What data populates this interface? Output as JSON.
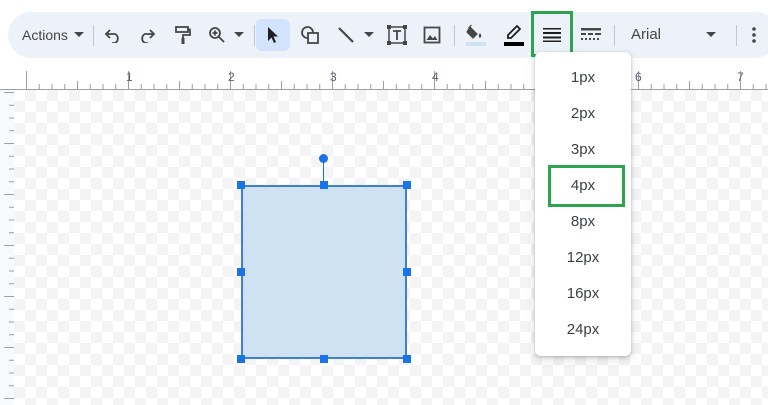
{
  "toolbar": {
    "actions_label": "Actions",
    "font_name": "Arial",
    "icons": [
      "undo-icon",
      "redo-icon",
      "paint-format-icon",
      "zoom-icon",
      "select-pointer-icon",
      "shape-icon",
      "line-icon",
      "text-box-icon",
      "image-icon",
      "fill-color-icon",
      "border-color-icon",
      "border-weight-icon",
      "border-dash-icon",
      "more-icon"
    ],
    "colors": {
      "bar": "#edf2fa",
      "selected": "#d3e3fd",
      "highlight": "#2ea44f"
    }
  },
  "ruler": {
    "numbers": [
      "1",
      "2",
      "3",
      "4",
      "6",
      "7"
    ]
  },
  "line_weight_menu": {
    "items": [
      "1px",
      "2px",
      "3px",
      "4px",
      "8px",
      "12px",
      "16px",
      "24px"
    ],
    "highlighted": "4px"
  },
  "shape": {
    "fill": "#cfe2f3",
    "border": "#3d7fd9"
  }
}
